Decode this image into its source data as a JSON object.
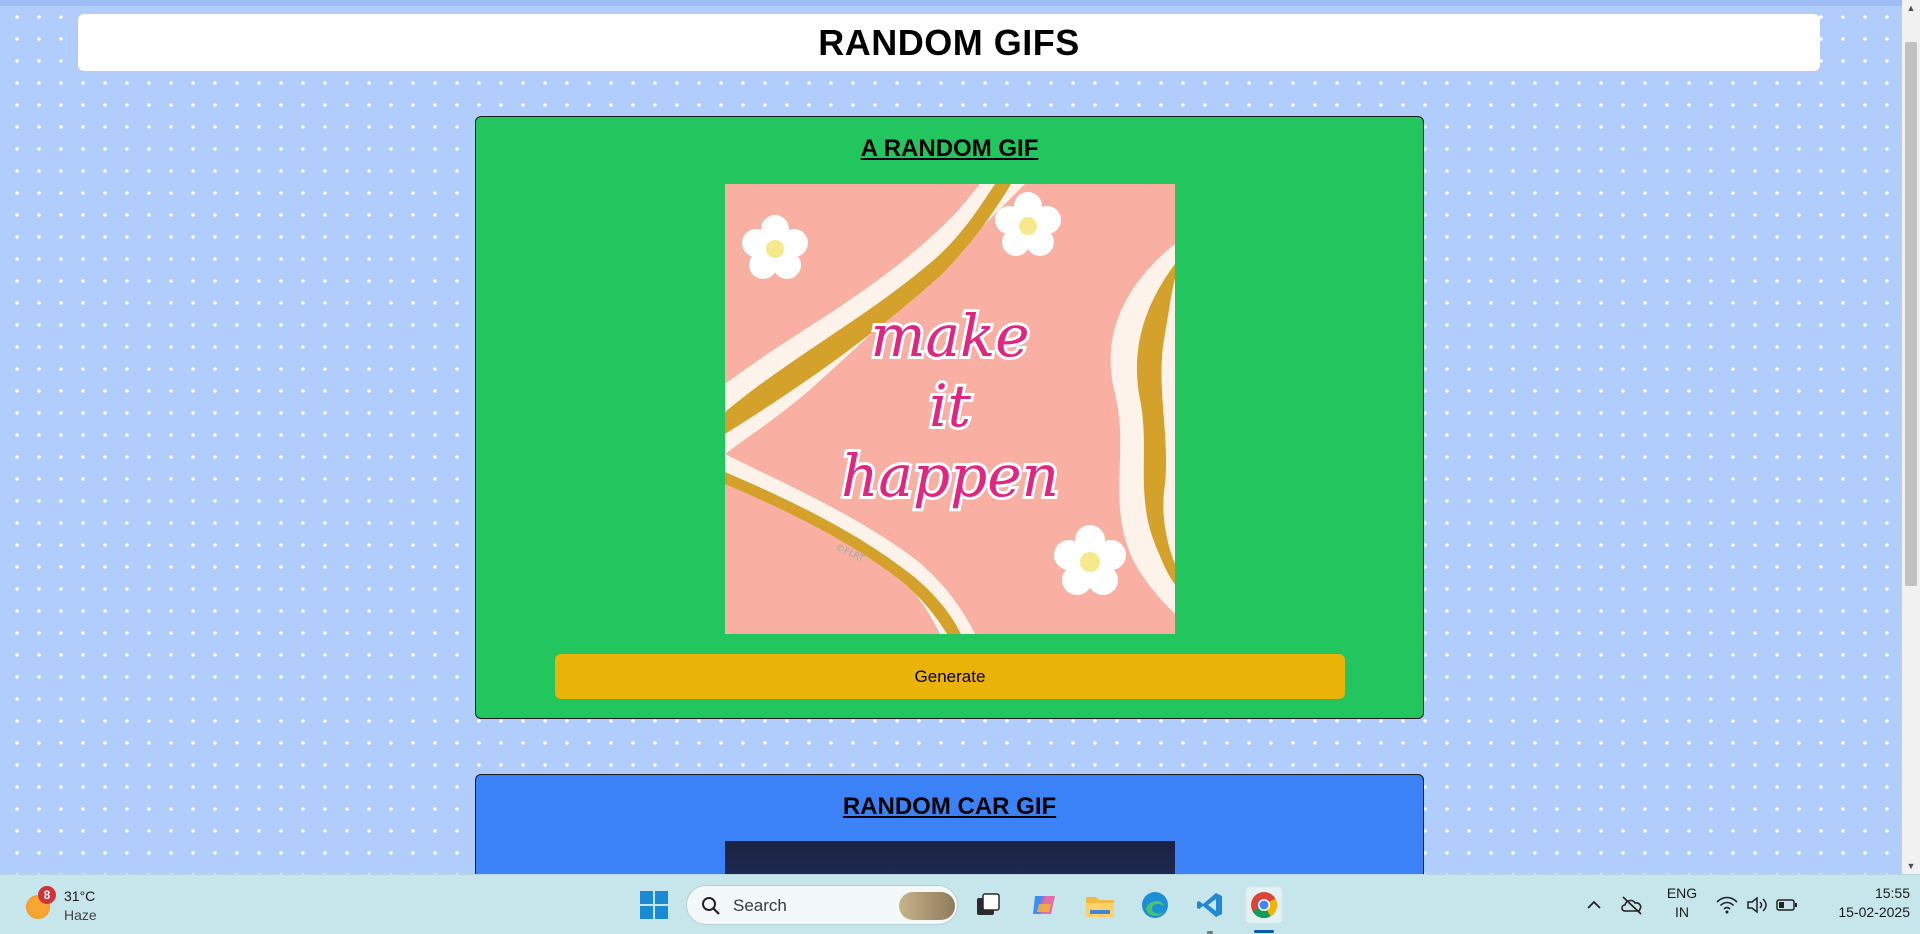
{
  "page": {
    "header_title": "RANDOM GIFS",
    "cards": [
      {
        "title": "A RANDOM GIF",
        "image_text": [
          "make",
          "it",
          "happen"
        ],
        "watermark": "©FLRT",
        "button_label": "Generate"
      },
      {
        "title": "RANDOM CAR GIF"
      }
    ]
  },
  "taskbar": {
    "weather": {
      "badge": "8",
      "temp": "31°C",
      "condition": "Haze"
    },
    "search_placeholder": "Search",
    "tray": {
      "language": "ENG",
      "region": "IN",
      "time": "15:55",
      "date": "15-02-2025"
    },
    "apps": [
      "windows-start",
      "search",
      "task-view",
      "copilot",
      "file-explorer",
      "edge",
      "vscode",
      "chrome"
    ]
  },
  "colors": {
    "page_bg": "#b1cdfb",
    "card_green": "#22c55e",
    "card_blue": "#3b82f6",
    "button": "#eab308",
    "taskbar": "#c7e6ec"
  }
}
